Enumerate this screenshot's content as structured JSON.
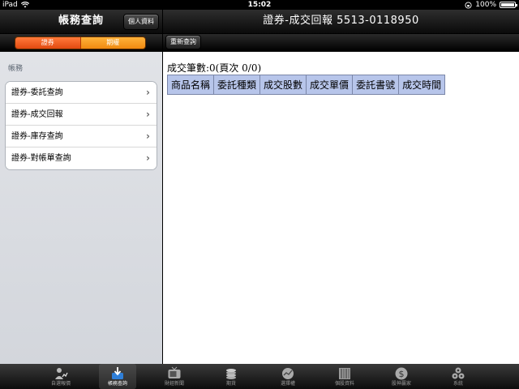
{
  "status_bar": {
    "device": "iPad",
    "time": "15:02",
    "battery": "100%"
  },
  "left": {
    "nav_title": "帳務查詢",
    "nav_button": "個人資料",
    "segments": [
      "證券",
      "期權"
    ],
    "section_label": "帳務",
    "items": [
      {
        "label": "證券-委託查詢"
      },
      {
        "label": "證券-成交回報"
      },
      {
        "label": "證券-庫存查詢"
      },
      {
        "label": "證券-對帳單查詢"
      }
    ]
  },
  "right": {
    "nav_title": "證券-成交回報 5513-0118950",
    "refresh_button": "重新查詢",
    "count_line": "成交筆數:0(頁次 0/0)",
    "table_headers": [
      "商品名稱",
      "委託種類",
      "成交股數",
      "成交單價",
      "委託書號",
      "成交時間"
    ]
  },
  "tab_bar": {
    "tabs": [
      {
        "label": "自選報價",
        "icon": "person-chart-icon"
      },
      {
        "label": "帳務查詢",
        "icon": "inbox-download-icon",
        "active": true
      },
      {
        "label": "財經新聞",
        "icon": "tv-icon"
      },
      {
        "label": "期貨",
        "icon": "coins-icon"
      },
      {
        "label": "選擇權",
        "icon": "globe-chart-icon"
      },
      {
        "label": "個股資料",
        "icon": "book-icon"
      },
      {
        "label": "股神贏家",
        "icon": "dollar-coin-icon"
      },
      {
        "label": "系統",
        "icon": "gears-icon"
      }
    ]
  },
  "colors": {
    "segment_active": "#e24a10",
    "segment_inactive": "#f18a10",
    "table_header_bg": "#b7c5ea"
  }
}
